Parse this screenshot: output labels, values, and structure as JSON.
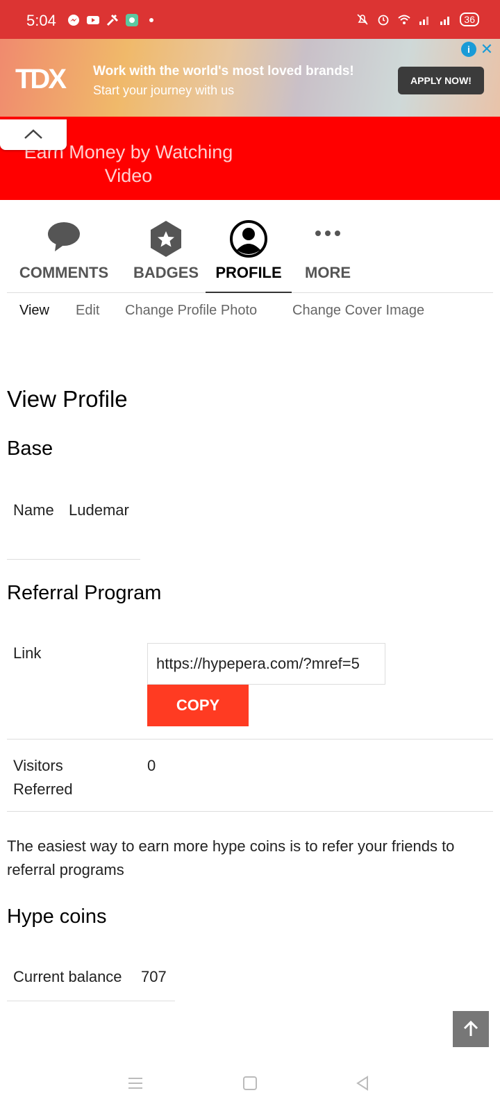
{
  "status_bar": {
    "time": "5:04",
    "battery": "36"
  },
  "ad": {
    "logo": "TDX",
    "headline": "Work with the world's most loved brands!",
    "subline": "Start your journey with us",
    "cta": "APPLY NOW!"
  },
  "header": {
    "tagline": "Earn Money by Watching Video"
  },
  "tabs": [
    {
      "label": "COMMENTS",
      "icon": "comment-icon"
    },
    {
      "label": "BADGES",
      "icon": "badge-star-icon"
    },
    {
      "label": "PROFILE",
      "icon": "profile-icon",
      "active": true
    },
    {
      "label": "MORE",
      "icon": "more-dots-icon"
    }
  ],
  "subtabs": [
    {
      "label": "View",
      "active": true
    },
    {
      "label": "Edit"
    },
    {
      "label": "Change Profile Photo"
    },
    {
      "label": "Change Cover Image"
    }
  ],
  "page_title": "View Profile",
  "base": {
    "heading": "Base",
    "name_label": "Name",
    "name_value": "Ludemar"
  },
  "referral": {
    "heading": "Referral Program",
    "link_label": "Link",
    "link_value": "https://hypepera.com/?mref=5",
    "copy_label": "COPY",
    "visitors_label": "Visitors Referred",
    "visitors_value": "0",
    "note": "The easiest way to earn more hype coins is to refer your friends to referral programs"
  },
  "coins": {
    "heading": "Hype coins",
    "balance_label": "Current balance",
    "balance_value": "707"
  },
  "colors": {
    "status_bar": "#dc3433",
    "header_red": "#ff0000",
    "copy_button": "#ff3b22"
  }
}
